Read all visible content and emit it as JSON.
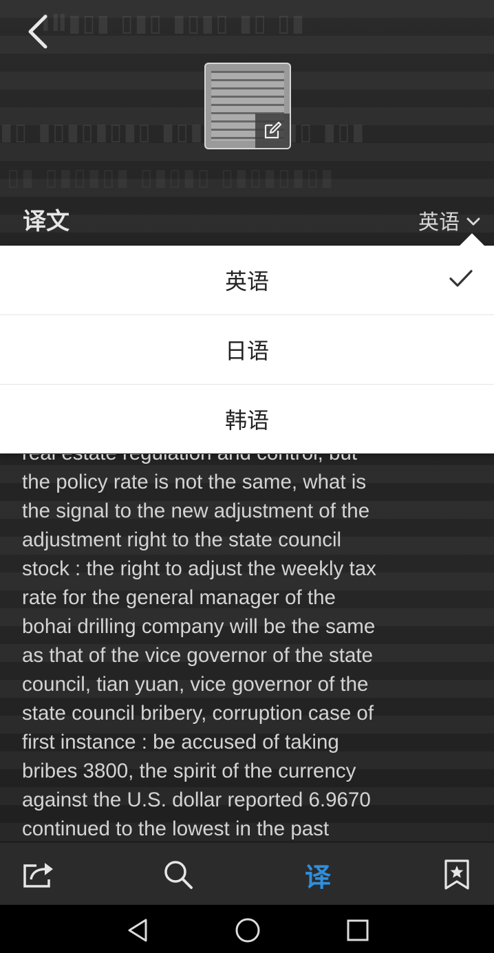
{
  "header": {
    "back_icon": "chevron-left-icon",
    "thumbnail_edit_icon": "edit-icon"
  },
  "section": {
    "label": "译文"
  },
  "language_selector": {
    "current": "英语",
    "icon": "chevron-down-icon"
  },
  "dropdown": {
    "options": [
      {
        "label": "英语",
        "selected": true
      },
      {
        "label": "日语",
        "selected": false
      },
      {
        "label": "韩语",
        "selected": false
      }
    ],
    "check_icon": "check-icon"
  },
  "translation": {
    "lines": [
      "real estate regulation and control, but",
      "the policy rate is not the same, what is",
      "the signal to the new adjustment of the",
      "adjustment right to the state council",
      "stock : the right to adjust the weekly tax",
      "rate for the general manager of the",
      "bohai drilling company will be the same",
      "as that of the vice governor of the state",
      "council, tian yuan, vice governor of the",
      "state council bribery, corruption case of",
      "first instance : be accused of taking",
      "bribes 3800, the spirit of the currency",
      "against the U.S. dollar reported 6.9670",
      "continued to the lowest in the past"
    ]
  },
  "bottom_bar": {
    "share_icon": "share-icon",
    "search_icon": "search-icon",
    "translate_label": "译",
    "bookmark_icon": "bookmark-star-icon",
    "accent_color": "#2f8fdc"
  },
  "nav_bar": {
    "back_icon": "triangle-back-icon",
    "home_icon": "circle-home-icon",
    "recents_icon": "square-recents-icon"
  }
}
